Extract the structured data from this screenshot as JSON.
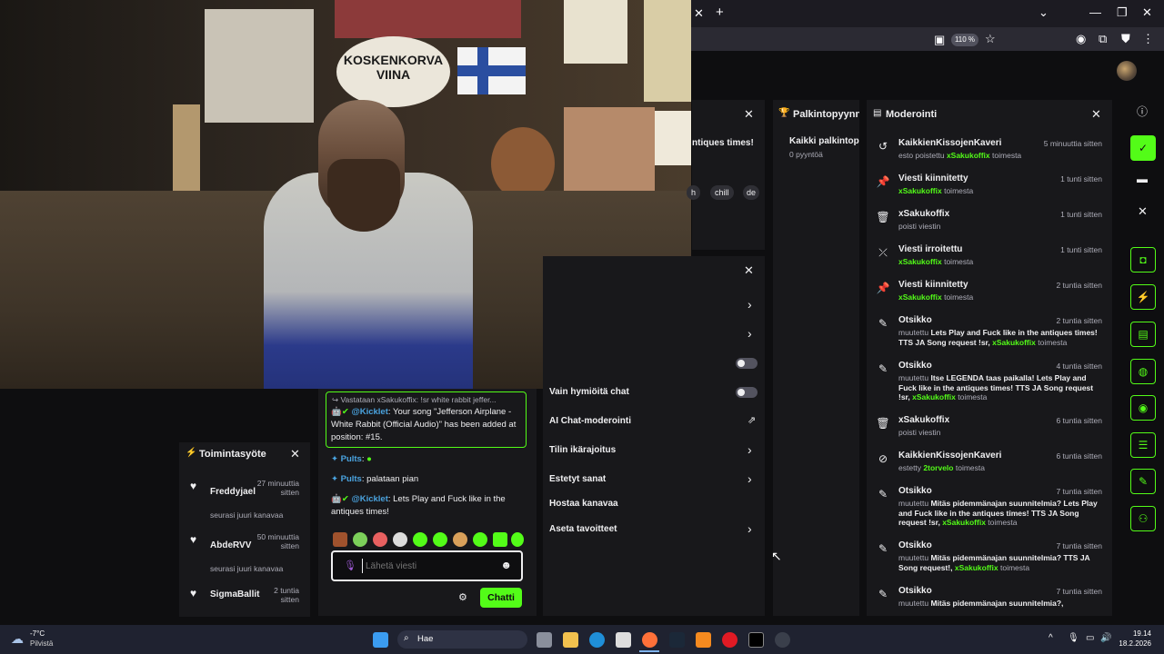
{
  "video": {
    "sign_text": "KOSKENKORVA VIINA"
  },
  "browser": {
    "zoom": "110 %"
  },
  "stream_info": {
    "title_fragment": "ntiques times!",
    "tags": [
      "h",
      "chill",
      "de"
    ]
  },
  "moderation": {
    "title": "Moderointi",
    "items": [
      {
        "icon": "undo-icon",
        "title": "KaikkienKissojenKaveri",
        "time": "5 minuuttia sitten",
        "d1": "esto poistettu",
        "user": "xSakukoffix",
        "d2": "toimesta"
      },
      {
        "icon": "pin-icon",
        "title": "Viesti kiinnitetty",
        "time": "1 tunti sitten",
        "d1": "",
        "user": "xSakukoffix",
        "d2": "toimesta"
      },
      {
        "icon": "trash-icon",
        "title": "xSakukoffix",
        "time": "1 tunti sitten",
        "d1": "poisti viestin",
        "user": "",
        "d2": ""
      },
      {
        "icon": "unpin-icon",
        "title": "Viesti irroitettu",
        "time": "1 tunti sitten",
        "d1": "",
        "user": "xSakukoffix",
        "d2": "toimesta"
      },
      {
        "icon": "pin-icon",
        "title": "Viesti kiinnitetty",
        "time": "2 tuntia sitten",
        "d1": "",
        "user": "xSakukoffix",
        "d2": "toimesta"
      },
      {
        "icon": "edit-title-icon",
        "title": "Otsikko",
        "time": "2 tuntia sitten",
        "d1": "muutettu",
        "bold": "Lets Play and Fuck like in the antiques times! TTS JA Song request !sr,",
        "user": "xSakukoffix",
        "d2": "toimesta"
      },
      {
        "icon": "edit-title-icon",
        "title": "Otsikko",
        "time": "4 tuntia sitten",
        "d1": "muutettu",
        "bold": "Itse LEGENDA taas paikalla! Lets Play and Fuck like in the antiques times! TTS JA Song request !sr,",
        "user": "xSakukoffix",
        "d2": "toimesta"
      },
      {
        "icon": "trash-icon",
        "title": "xSakukoffix",
        "time": "6 tuntia sitten",
        "d1": "poisti viestin",
        "user": "",
        "d2": ""
      },
      {
        "icon": "ban-icon",
        "title": "KaikkienKissojenKaveri",
        "time": "6 tuntia sitten",
        "d1": "estetty",
        "user": "2torvelo",
        "d2": "toimesta"
      },
      {
        "icon": "edit-title-icon",
        "title": "Otsikko",
        "time": "7 tuntia sitten",
        "d1": "muutettu",
        "bold": "Mitäs pidemmänajan suunnitelmia? Lets Play and Fuck like in the antiques times! TTS JA Song request !sr,",
        "user": "xSakukoffix",
        "d2": "toimesta"
      },
      {
        "icon": "edit-title-icon",
        "title": "Otsikko",
        "time": "7 tuntia sitten",
        "d1": "muutettu",
        "bold": "Mitäs pidemmänajan suunnitelmia? TTS JA Song request!,",
        "user": "xSakukoffix",
        "d2": "toimesta"
      },
      {
        "icon": "edit-title-icon",
        "title": "Otsikko",
        "time": "7 tuntia sitten",
        "d1": "muutettu",
        "bold": "Mitäs pidemmänajan suunnitelmia?,",
        "user": "",
        "d2": ""
      }
    ]
  },
  "rewards": {
    "title": "Palkintopyynnöt",
    "all": "Kaikki palkintop",
    "count": "0 pyyntöä"
  },
  "settings": {
    "items": [
      {
        "label": "Vain hymiöitä chat",
        "control": "toggle"
      },
      {
        "label": "AI Chat-moderointi",
        "control": "external"
      },
      {
        "label": "Tilin ikärajoitus",
        "control": "chevron"
      },
      {
        "label": "Estetyt sanat",
        "control": "chevron"
      },
      {
        "label": "Hostaa kanavaa",
        "control": "none"
      },
      {
        "label": "Aseta tavoitteet",
        "control": "chevron"
      }
    ]
  },
  "chat": {
    "reply_to": "Vastataan xSakukoffix: !sr white rabbit jeffer...",
    "bot1_user": "@Kicklet",
    "bot1_text": ": Your song \"Jefferson Airplane - White Rabbit (Official Audio)\" has been added at position: #15.",
    "m2_user": "Pults",
    "m3_user": "Pults",
    "m3_text": ": palataan pian",
    "bot2_user": "@Kicklet",
    "bot2_text": ": Lets Play and Fuck like in the antiques times!",
    "placeholder": "Lähetä viesti",
    "send": "Chatti"
  },
  "activity": {
    "title": "Toimintasyöte",
    "items": [
      {
        "name": "Freddyjael",
        "time": "27 minuuttia sitten",
        "sub": "seurasi juuri kanavaa"
      },
      {
        "name": "AbdeRVV",
        "time": "50 minuuttia sitten",
        "sub": "seurasi juuri kanavaa"
      },
      {
        "name": "SigmaBallit",
        "time": "2 tuntia sitten",
        "sub": ""
      }
    ]
  },
  "taskbar": {
    "weather_temp": "-7°C",
    "weather_desc": "Pilvistä",
    "search": "Hae",
    "time": "19.14",
    "date": "18.2.2026"
  },
  "colors": {
    "accent": "#53fc18",
    "panel": "#18181b",
    "bg": "#0e0e10"
  }
}
